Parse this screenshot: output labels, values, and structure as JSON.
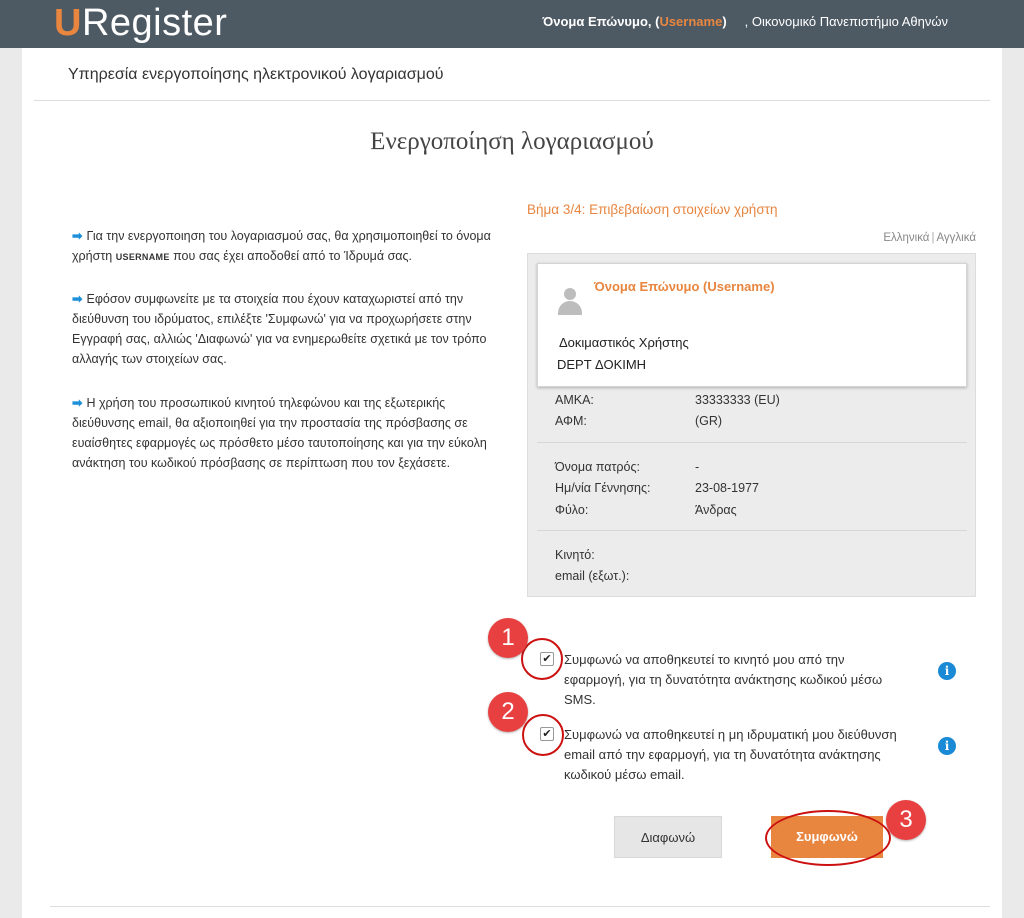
{
  "header": {
    "brand_first": "U",
    "brand_rest": "Register",
    "user_name": "Όνομα Επώνυμο, (",
    "username": "Username",
    "user_close": ")",
    "institution_sep": ",",
    "institution": "Οικονομικό Πανεπιστήμιο Αθηνών"
  },
  "page": {
    "service_title": "Υπηρεσία ενεργοποίησης ηλεκτρονικού λογαριασμού",
    "main_title": "Ενεργοποίηση λογαριασμού"
  },
  "info": {
    "p1_a": "Για την ενεργοποιηση του λογαριασμού σας, θα χρησιμοποιηθεί το όνομα χρήστη",
    "p1_username": "USERNAME",
    "p1_b": "που σας έχει αποδοθεί από το Ίδρυμά σας.",
    "p2": "Εφόσον συμφωνείτε με τα στοιχεία που έχουν καταχωριστεί από την διεύθυνση του ιδρύματος, επιλέξτε 'Συμφωνώ' για να προχωρήσετε στην Εγγραφή σας, αλλιώς 'Διαφωνώ' για να ενημερωθείτε σχετικά με τον τρόπο αλλαγής των στοιχείων σας.",
    "p3": "Η χρήση του προσωπικού κινητού τηλεφώνου και της εξωτερικής διεύθυνσης email, θα αξιοποιηθεί για την προστασία της πρόσβασης σε ευαίσθητες εφαρμογές ως πρόσθετο μέσο ταυτοποίησης και για την εύκολη ανάκτηση του κωδικού πρόσβασης σε περίπτωση που τον ξεχάσετε."
  },
  "step": {
    "title": "Βήμα 3/4: Επιβεβαίωση στοιχείων χρήστη",
    "lang_greek": "Ελληνικά",
    "lang_sep": "|",
    "lang_english": "Αγγλικά"
  },
  "card": {
    "name": "Όνομα Επώνυμο (Username)",
    "role": "Δοκιμαστικός Χρήστης",
    "dept": "DEPT ΔΟΚΙΜΗ"
  },
  "details": {
    "amka_label": "ΑΜΚΑ:",
    "amka_value": "33333333 (EU)",
    "afm_label": "ΑΦΜ:",
    "afm_value": "(GR)",
    "father_label": "Όνομα πατρός:",
    "father_value": "-",
    "dob_label": "Ημ/νία Γέννησης:",
    "dob_value": "23-08-1977",
    "gender_label": "Φύλο:",
    "gender_value": "Άνδρας",
    "mobile_label": "Κινητό:",
    "email_label": "email (εξωτ.):"
  },
  "consents": {
    "sms_text": "Συμφωνώ να αποθηκευτεί το κινητό μου από την εφαρμογή, για τη δυνατότητα ανάκτησης κωδικού μέσω SMS.",
    "sms_checked": true,
    "email_text": "Συμφωνώ να αποθηκευτεί η μη ιδρυματική μου διεύθυνση email από την εφαρμογή, για τη δυνατότητα ανάκτησης κωδικού μέσω email.",
    "email_checked": true,
    "check_glyph": "✔",
    "info_glyph": "i"
  },
  "annotations": {
    "badge1": "1",
    "badge2": "2",
    "badge3": "3",
    "color": "#e84040"
  },
  "buttons": {
    "disagree": "Διαφωνώ",
    "agree": "Συμφωνώ"
  },
  "colors": {
    "accent": "#e8853f",
    "topbar": "#4d5a64",
    "info_blue": "#1a8ad6"
  }
}
